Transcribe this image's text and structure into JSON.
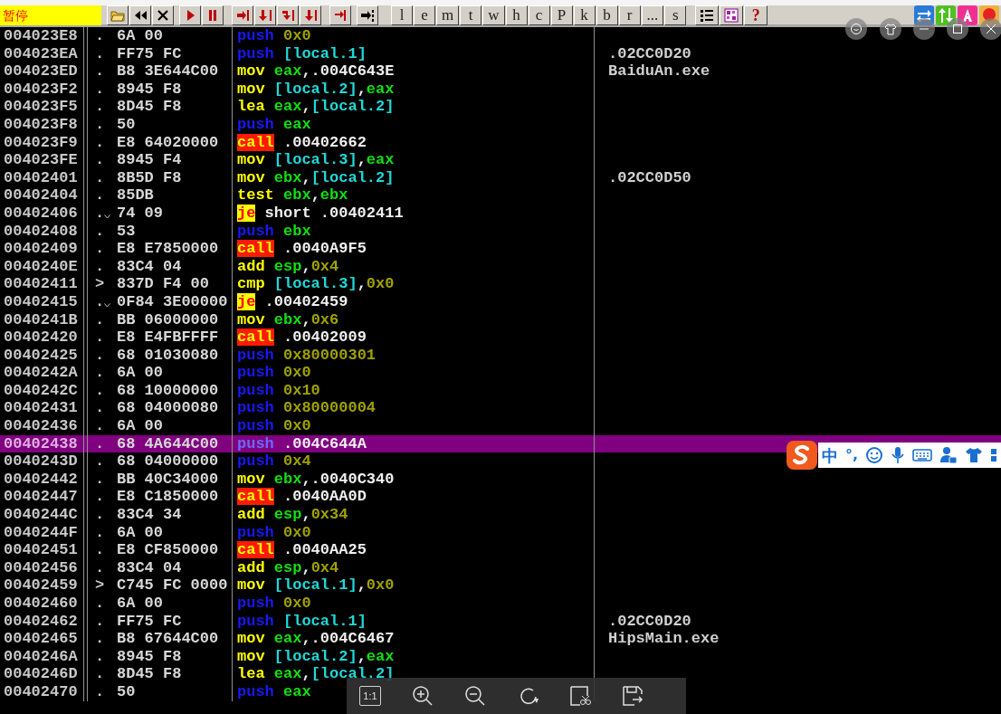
{
  "toolbar": {
    "status": "暂停",
    "letter_buttons": [
      "l",
      "e",
      "m",
      "t",
      "w",
      "h",
      "c",
      "P",
      "k",
      "b",
      "r",
      "...",
      "s"
    ],
    "help_button": "?"
  },
  "rows": [
    {
      "address": "004023E8",
      "marker": ".",
      "branch": false,
      "hex": "6A 00",
      "instruction": [
        {
          "text": "push ",
          "kind": "push"
        },
        {
          "text": "0x0",
          "kind": "const"
        }
      ],
      "selected": false
    },
    {
      "address": "004023EA",
      "marker": ".",
      "branch": false,
      "hex": "FF75 FC",
      "instruction": [
        {
          "text": "push ",
          "kind": "push"
        },
        {
          "text": "[local.1]",
          "kind": "mem"
        }
      ],
      "comment": ".02CC0D20",
      "selected": false
    },
    {
      "address": "004023ED",
      "marker": ".",
      "branch": false,
      "hex": "B8 3E644C00",
      "instruction": [
        {
          "text": "mov ",
          "kind": "op"
        },
        {
          "text": "eax",
          "kind": "reg"
        },
        {
          "text": ",.004C643E",
          "kind": "text"
        }
      ],
      "comment": "BaiduAn.exe",
      "selected": false
    },
    {
      "address": "004023F2",
      "marker": ".",
      "branch": false,
      "hex": "8945 F8",
      "instruction": [
        {
          "text": "mov ",
          "kind": "op"
        },
        {
          "text": "[local.2]",
          "kind": "mem"
        },
        {
          "text": ",",
          "kind": "text"
        },
        {
          "text": "eax",
          "kind": "reg"
        }
      ],
      "selected": false
    },
    {
      "address": "004023F5",
      "marker": ".",
      "branch": false,
      "hex": "8D45 F8",
      "instruction": [
        {
          "text": "lea ",
          "kind": "op"
        },
        {
          "text": "eax",
          "kind": "reg"
        },
        {
          "text": ",",
          "kind": "text"
        },
        {
          "text": "[local.2]",
          "kind": "mem"
        }
      ],
      "selected": false
    },
    {
      "address": "004023F8",
      "marker": ".",
      "branch": false,
      "hex": "50",
      "instruction": [
        {
          "text": "push ",
          "kind": "push"
        },
        {
          "text": "eax",
          "kind": "reg"
        }
      ],
      "selected": false
    },
    {
      "address": "004023F9",
      "marker": ".",
      "branch": false,
      "hex": "E8 64020000",
      "instruction": [
        {
          "text": "call",
          "kind": "call"
        },
        {
          "text": " .00402662",
          "kind": "text"
        }
      ],
      "selected": false
    },
    {
      "address": "004023FE",
      "marker": ".",
      "branch": false,
      "hex": "8945 F4",
      "instruction": [
        {
          "text": "mov ",
          "kind": "op"
        },
        {
          "text": "[local.3]",
          "kind": "mem"
        },
        {
          "text": ",",
          "kind": "text"
        },
        {
          "text": "eax",
          "kind": "reg"
        }
      ],
      "selected": false
    },
    {
      "address": "00402401",
      "marker": ".",
      "branch": false,
      "hex": "8B5D F8",
      "instruction": [
        {
          "text": "mov ",
          "kind": "op"
        },
        {
          "text": "ebx",
          "kind": "reg"
        },
        {
          "text": ",",
          "kind": "text"
        },
        {
          "text": "[local.2]",
          "kind": "mem"
        }
      ],
      "comment": ".02CC0D50",
      "selected": false
    },
    {
      "address": "00402404",
      "marker": ".",
      "branch": false,
      "hex": "85DB",
      "instruction": [
        {
          "text": "test ",
          "kind": "op"
        },
        {
          "text": "ebx",
          "kind": "reg"
        },
        {
          "text": ",",
          "kind": "text"
        },
        {
          "text": "ebx",
          "kind": "reg"
        }
      ],
      "selected": false
    },
    {
      "address": "00402406",
      "marker": ".",
      "branch": true,
      "hex": "74 09",
      "instruction": [
        {
          "text": "je",
          "kind": "jump"
        },
        {
          "text": " short .00402411",
          "kind": "text"
        }
      ],
      "selected": false
    },
    {
      "address": "00402408",
      "marker": ".",
      "branch": false,
      "hex": "53",
      "instruction": [
        {
          "text": "push ",
          "kind": "push"
        },
        {
          "text": "ebx",
          "kind": "reg"
        }
      ],
      "selected": false
    },
    {
      "address": "00402409",
      "marker": ".",
      "branch": false,
      "hex": "E8 E7850000",
      "instruction": [
        {
          "text": "call",
          "kind": "call"
        },
        {
          "text": " .0040A9F5",
          "kind": "text"
        }
      ],
      "selected": false
    },
    {
      "address": "0040240E",
      "marker": ".",
      "branch": false,
      "hex": "83C4 04",
      "instruction": [
        {
          "text": "add ",
          "kind": "op"
        },
        {
          "text": "esp",
          "kind": "reg"
        },
        {
          "text": ",",
          "kind": "text"
        },
        {
          "text": "0x4",
          "kind": "const"
        }
      ],
      "selected": false
    },
    {
      "address": "00402411",
      "marker": ">",
      "branch": false,
      "hex": "837D F4 00",
      "instruction": [
        {
          "text": "cmp ",
          "kind": "op"
        },
        {
          "text": "[local.3]",
          "kind": "mem"
        },
        {
          "text": ",",
          "kind": "text"
        },
        {
          "text": "0x0",
          "kind": "const"
        }
      ],
      "selected": false
    },
    {
      "address": "00402415",
      "marker": ".",
      "branch": true,
      "hex": "0F84 3E00000",
      "instruction": [
        {
          "text": "je",
          "kind": "jump"
        },
        {
          "text": " .00402459",
          "kind": "text"
        }
      ],
      "selected": false
    },
    {
      "address": "0040241B",
      "marker": ".",
      "branch": false,
      "hex": "BB 06000000",
      "instruction": [
        {
          "text": "mov ",
          "kind": "op"
        },
        {
          "text": "ebx",
          "kind": "reg"
        },
        {
          "text": ",",
          "kind": "text"
        },
        {
          "text": "0x6",
          "kind": "const"
        }
      ],
      "selected": false
    },
    {
      "address": "00402420",
      "marker": ".",
      "branch": false,
      "hex": "E8 E4FBFFFF",
      "instruction": [
        {
          "text": "call",
          "kind": "call"
        },
        {
          "text": " .00402009",
          "kind": "text"
        }
      ],
      "selected": false
    },
    {
      "address": "00402425",
      "marker": ".",
      "branch": false,
      "hex": "68 01030080",
      "instruction": [
        {
          "text": "push ",
          "kind": "push"
        },
        {
          "text": "0x80000301",
          "kind": "const"
        }
      ],
      "selected": false
    },
    {
      "address": "0040242A",
      "marker": ".",
      "branch": false,
      "hex": "6A 00",
      "instruction": [
        {
          "text": "push ",
          "kind": "push"
        },
        {
          "text": "0x0",
          "kind": "const"
        }
      ],
      "selected": false
    },
    {
      "address": "0040242C",
      "marker": ".",
      "branch": false,
      "hex": "68 10000000",
      "instruction": [
        {
          "text": "push ",
          "kind": "push"
        },
        {
          "text": "0x10",
          "kind": "const"
        }
      ],
      "selected": false
    },
    {
      "address": "00402431",
      "marker": ".",
      "branch": false,
      "hex": "68 04000080",
      "instruction": [
        {
          "text": "push ",
          "kind": "push"
        },
        {
          "text": "0x80000004",
          "kind": "const"
        }
      ],
      "selected": false
    },
    {
      "address": "00402436",
      "marker": ".",
      "branch": false,
      "hex": "6A 00",
      "instruction": [
        {
          "text": "push ",
          "kind": "push"
        },
        {
          "text": "0x0",
          "kind": "const"
        }
      ],
      "selected": false
    },
    {
      "address": "00402438",
      "marker": ".",
      "branch": false,
      "hex": "68 4A644C00",
      "instruction": [
        {
          "text": "push",
          "kind": "push"
        },
        {
          "text": " .004C644A",
          "kind": "text"
        }
      ],
      "selected": true
    },
    {
      "address": "0040243D",
      "marker": ".",
      "branch": false,
      "hex": "68 04000000",
      "instruction": [
        {
          "text": "push ",
          "kind": "push"
        },
        {
          "text": "0x4",
          "kind": "const"
        }
      ],
      "selected": false
    },
    {
      "address": "00402442",
      "marker": ".",
      "branch": false,
      "hex": "BB 40C34000",
      "instruction": [
        {
          "text": "mov ",
          "kind": "op"
        },
        {
          "text": "ebx",
          "kind": "reg"
        },
        {
          "text": ",.0040C340",
          "kind": "text"
        }
      ],
      "selected": false
    },
    {
      "address": "00402447",
      "marker": ".",
      "branch": false,
      "hex": "E8 C1850000",
      "instruction": [
        {
          "text": "call",
          "kind": "call"
        },
        {
          "text": " .0040AA0D",
          "kind": "text"
        }
      ],
      "selected": false
    },
    {
      "address": "0040244C",
      "marker": ".",
      "branch": false,
      "hex": "83C4 34",
      "instruction": [
        {
          "text": "add ",
          "kind": "op"
        },
        {
          "text": "esp",
          "kind": "reg"
        },
        {
          "text": ",",
          "kind": "text"
        },
        {
          "text": "0x34",
          "kind": "const"
        }
      ],
      "selected": false
    },
    {
      "address": "0040244F",
      "marker": ".",
      "branch": false,
      "hex": "6A 00",
      "instruction": [
        {
          "text": "push ",
          "kind": "push"
        },
        {
          "text": "0x0",
          "kind": "const"
        }
      ],
      "selected": false
    },
    {
      "address": "00402451",
      "marker": ".",
      "branch": false,
      "hex": "E8 CF850000",
      "instruction": [
        {
          "text": "call",
          "kind": "call"
        },
        {
          "text": " .0040AA25",
          "kind": "text"
        }
      ],
      "selected": false
    },
    {
      "address": "00402456",
      "marker": ".",
      "branch": false,
      "hex": "83C4 04",
      "instruction": [
        {
          "text": "add ",
          "kind": "op"
        },
        {
          "text": "esp",
          "kind": "reg"
        },
        {
          "text": ",",
          "kind": "text"
        },
        {
          "text": "0x4",
          "kind": "const"
        }
      ],
      "selected": false
    },
    {
      "address": "00402459",
      "marker": ">",
      "branch": false,
      "hex": "C745 FC 0000",
      "instruction": [
        {
          "text": "mov ",
          "kind": "op"
        },
        {
          "text": "[local.1]",
          "kind": "mem"
        },
        {
          "text": ",",
          "kind": "text"
        },
        {
          "text": "0x0",
          "kind": "const"
        }
      ],
      "selected": false
    },
    {
      "address": "00402460",
      "marker": ".",
      "branch": false,
      "hex": "6A 00",
      "instruction": [
        {
          "text": "push ",
          "kind": "push"
        },
        {
          "text": "0x0",
          "kind": "const"
        }
      ],
      "selected": false
    },
    {
      "address": "00402462",
      "marker": ".",
      "branch": false,
      "hex": "FF75 FC",
      "instruction": [
        {
          "text": "push ",
          "kind": "push"
        },
        {
          "text": "[local.1]",
          "kind": "mem"
        }
      ],
      "comment": ".02CC0D20",
      "selected": false
    },
    {
      "address": "00402465",
      "marker": ".",
      "branch": false,
      "hex": "B8 67644C00",
      "instruction": [
        {
          "text": "mov ",
          "kind": "op"
        },
        {
          "text": "eax",
          "kind": "reg"
        },
        {
          "text": ",.004C6467",
          "kind": "text"
        }
      ],
      "comment": "HipsMain.exe",
      "selected": false
    },
    {
      "address": "0040246A",
      "marker": ".",
      "branch": false,
      "hex": "8945 F8",
      "instruction": [
        {
          "text": "mov ",
          "kind": "op"
        },
        {
          "text": "[local.2]",
          "kind": "mem"
        },
        {
          "text": ",",
          "kind": "text"
        },
        {
          "text": "eax",
          "kind": "reg"
        }
      ],
      "selected": false
    },
    {
      "address": "0040246D",
      "marker": ".",
      "branch": false,
      "hex": "8D45 F8",
      "instruction": [
        {
          "text": "lea ",
          "kind": "op"
        },
        {
          "text": "eax",
          "kind": "reg"
        },
        {
          "text": ",",
          "kind": "text"
        },
        {
          "text": "[local.2]",
          "kind": "mem"
        }
      ],
      "selected": false
    },
    {
      "address": "00402470",
      "marker": ".",
      "branch": false,
      "hex": "50",
      "instruction": [
        {
          "text": "push ",
          "kind": "push"
        },
        {
          "text": "eax",
          "kind": "reg"
        }
      ],
      "selected": false
    }
  ],
  "ime_bar": {
    "mode": "中",
    "punctuation": "°,"
  },
  "viewer_toolbar": {
    "actual_size": "1:1"
  }
}
